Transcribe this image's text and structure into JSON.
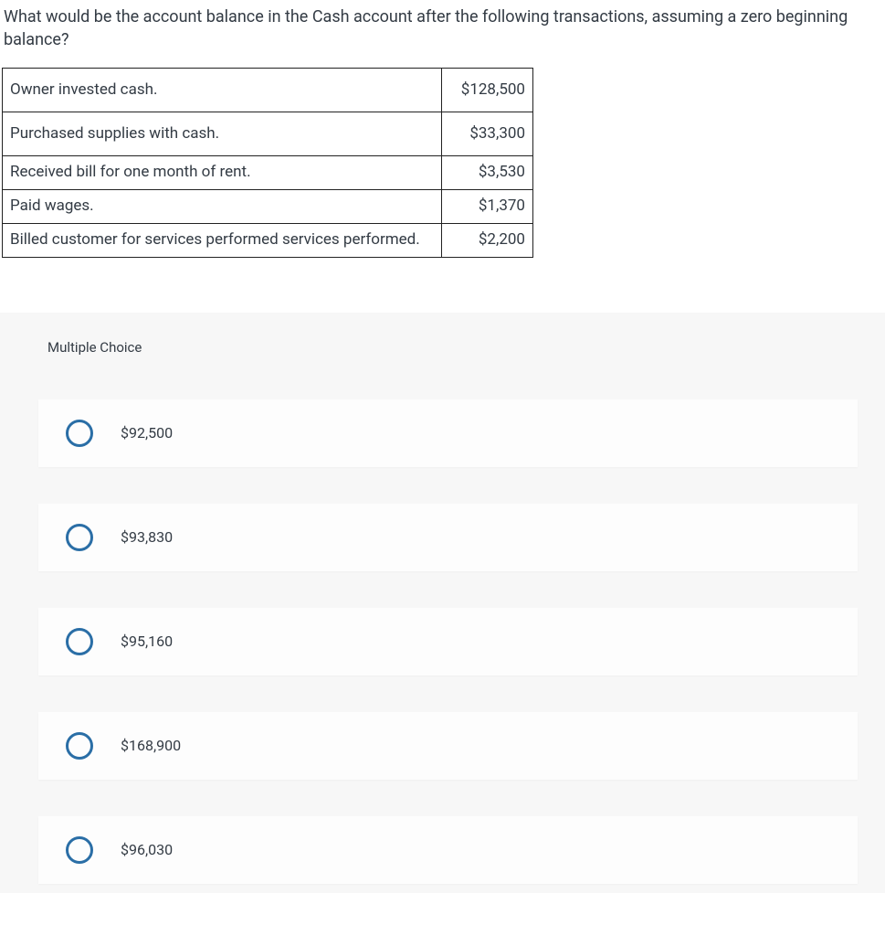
{
  "question": "What would be the account balance in the Cash account after the following transactions, assuming a zero beginning balance?",
  "transactions": [
    {
      "desc": "Owner invested cash.",
      "amount": "$128,500"
    },
    {
      "desc": "Purchased supplies with cash.",
      "amount": "$33,300"
    },
    {
      "desc": "Received bill for one month of rent.",
      "amount": "$3,530"
    },
    {
      "desc": "Paid wages.",
      "amount": "$1,370"
    },
    {
      "desc": "Billed customer for services performed services performed.",
      "amount": "$2,200"
    }
  ],
  "mc_heading": "Multiple Choice",
  "options": [
    {
      "label": "$92,500"
    },
    {
      "label": "$93,830"
    },
    {
      "label": "$95,160"
    },
    {
      "label": "$168,900"
    },
    {
      "label": "$96,030"
    }
  ]
}
